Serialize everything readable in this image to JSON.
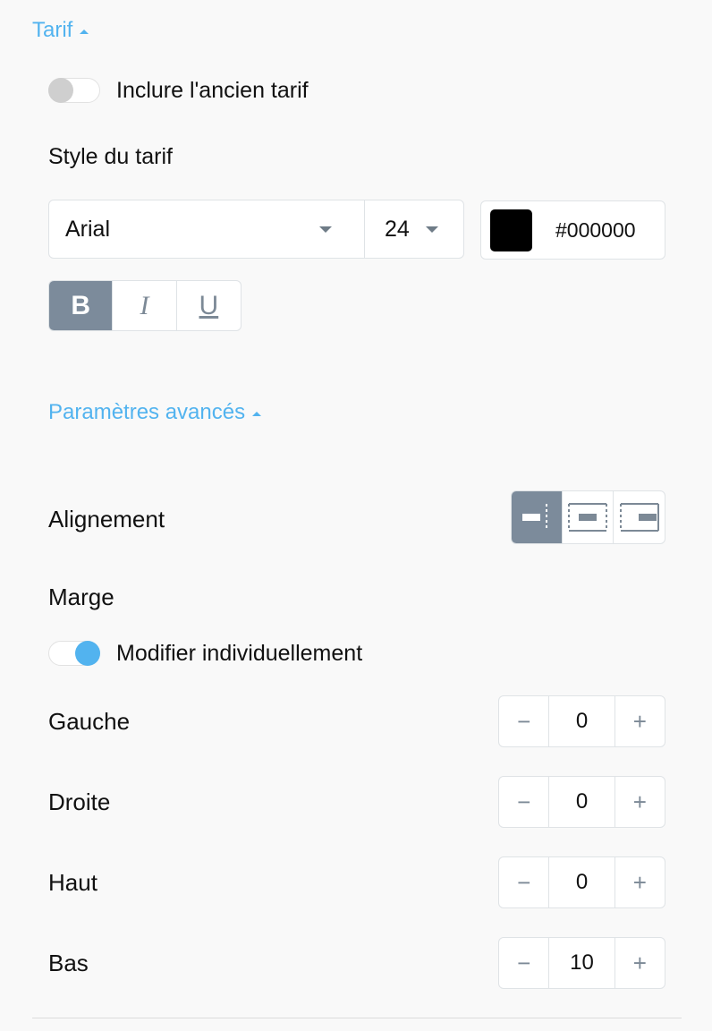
{
  "section": {
    "title": "Tarif"
  },
  "old_price_toggle": {
    "label": "Inclure l'ancien tarif",
    "on": false
  },
  "price_style": {
    "heading": "Style du tarif",
    "font": "Arial",
    "size": "24",
    "color_hex": "#000000",
    "color_swatch": "#000000",
    "format": {
      "bold": "B",
      "italic": "I",
      "underline": "U",
      "active": "bold"
    }
  },
  "advanced": {
    "title": "Paramètres avancés"
  },
  "alignment": {
    "label": "Alignement",
    "options": [
      "left-icon",
      "center-icon",
      "right-icon"
    ],
    "active": "left"
  },
  "margin": {
    "heading": "Marge",
    "individual_toggle": {
      "label": "Modifier individuellement",
      "on": true
    },
    "fields": [
      {
        "label": "Gauche",
        "value": "0"
      },
      {
        "label": "Droite",
        "value": "0"
      },
      {
        "label": "Haut",
        "value": "0"
      },
      {
        "label": "Bas",
        "value": "10"
      }
    ],
    "minus": "−",
    "plus": "+"
  },
  "colors": {
    "accent": "#52b3ef",
    "active_btn": "#7c8b9b"
  }
}
